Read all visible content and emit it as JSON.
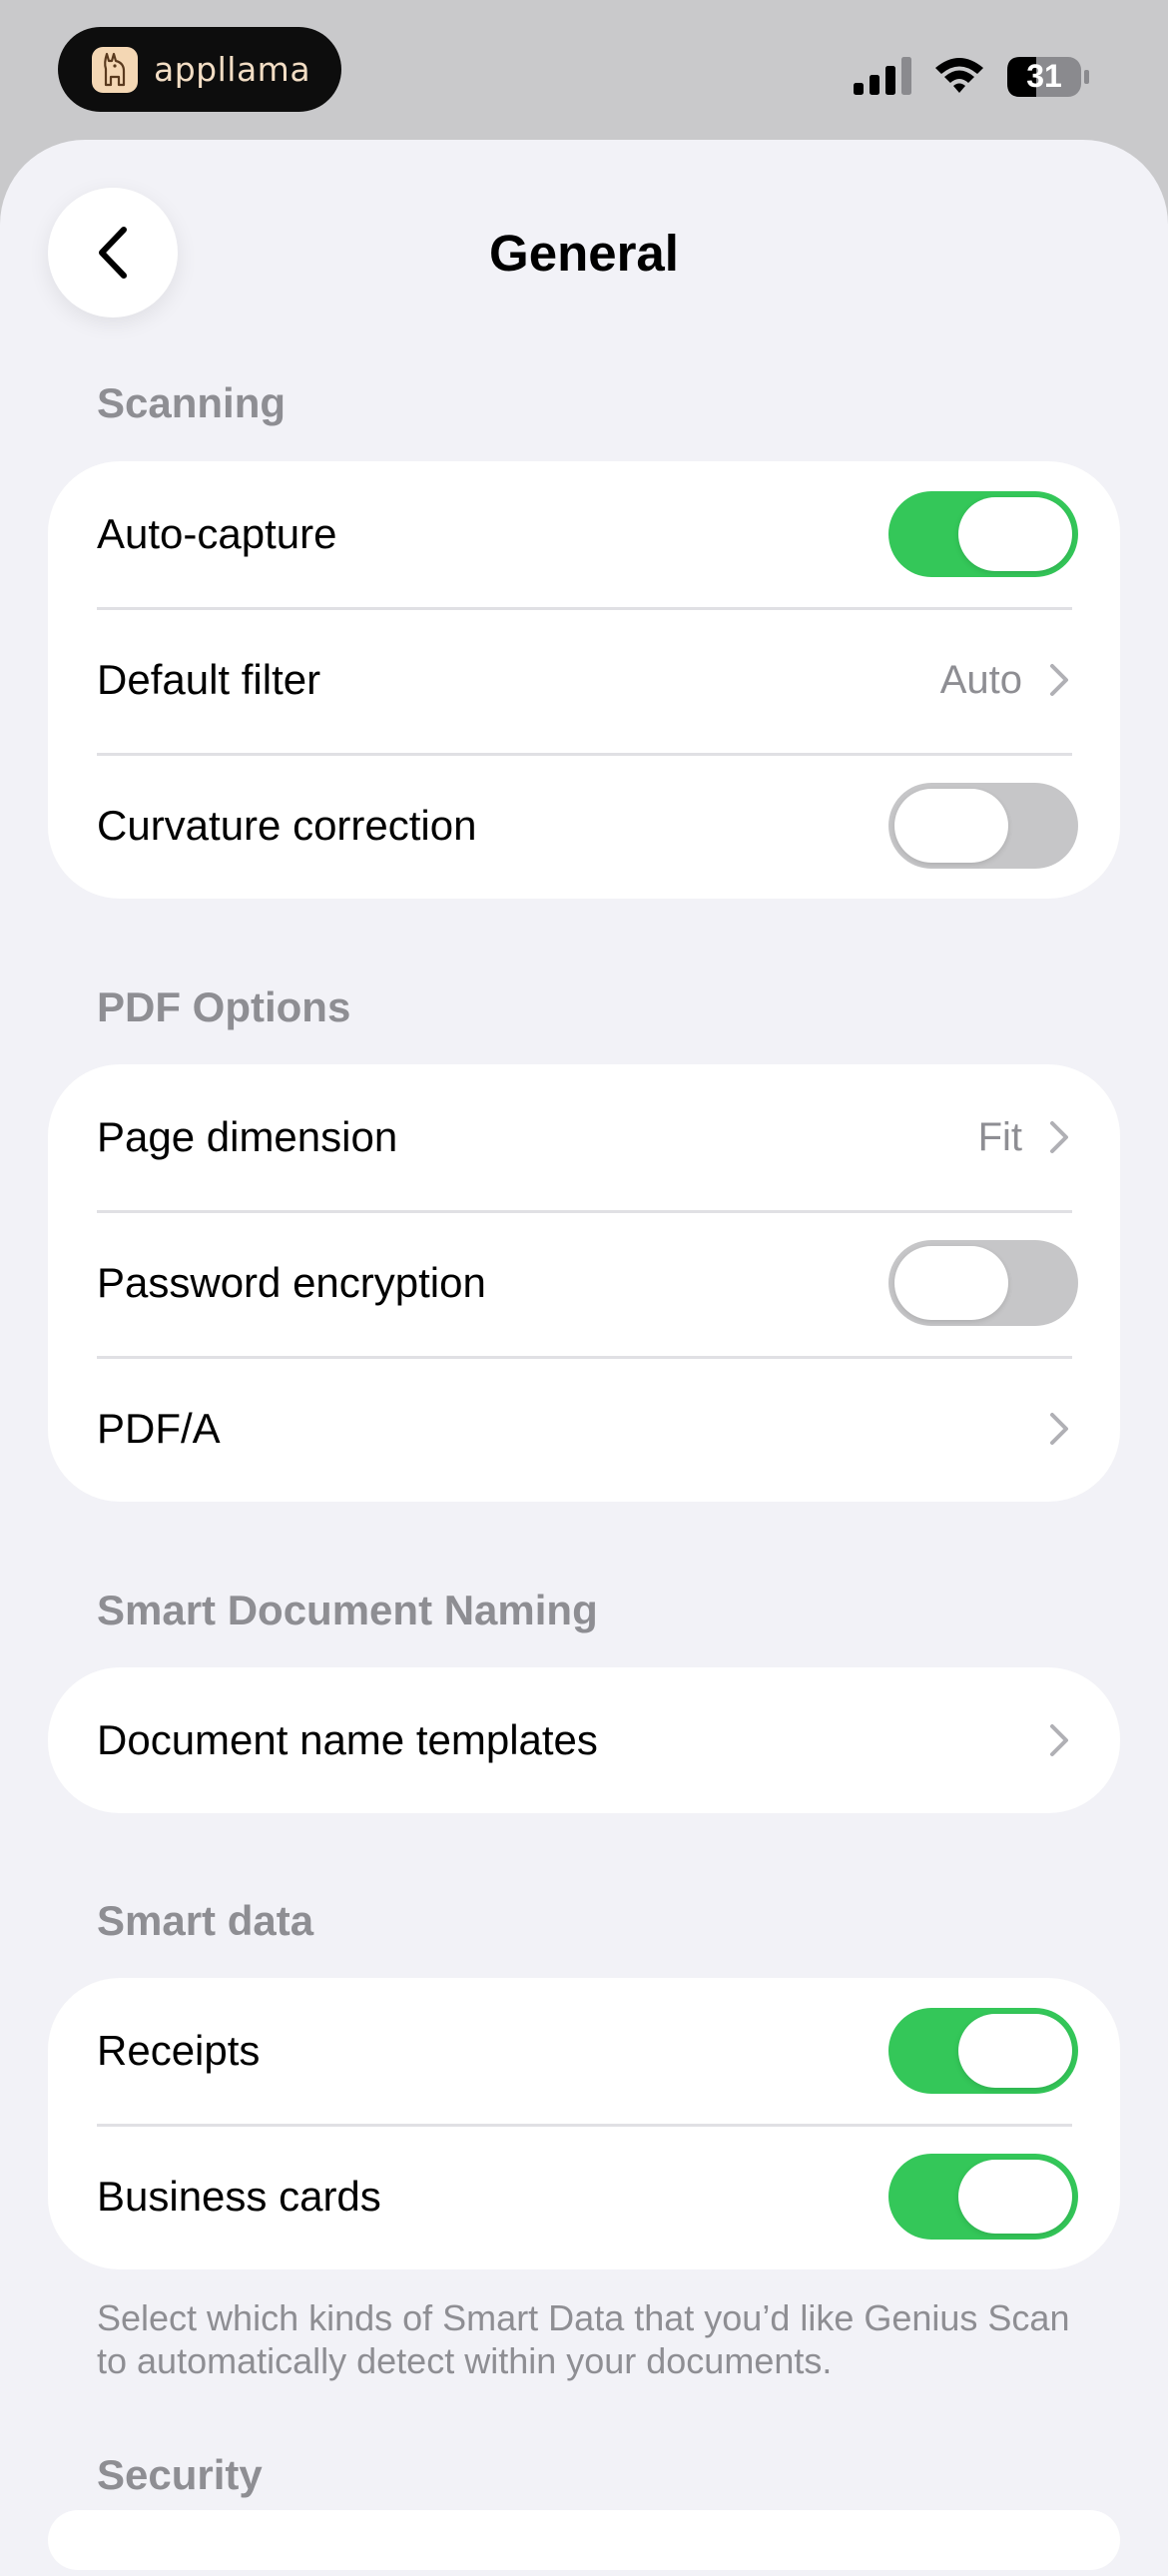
{
  "status_bar": {
    "brand_name": "appllama",
    "battery_level": "31",
    "icons": [
      "cellular-signal-icon",
      "wifi-icon",
      "battery-icon"
    ]
  },
  "nav": {
    "title": "General",
    "back_icon": "chevron-left-icon"
  },
  "sections": {
    "scanning": {
      "header": "Scanning",
      "rows": [
        {
          "label": "Auto-capture",
          "type": "toggle",
          "on": true
        },
        {
          "label": "Default filter",
          "type": "disclosure",
          "value": "Auto"
        },
        {
          "label": "Curvature correction",
          "type": "toggle",
          "on": false
        }
      ]
    },
    "pdf_options": {
      "header": "PDF Options",
      "rows": [
        {
          "label": "Page dimension",
          "type": "disclosure",
          "value": "Fit"
        },
        {
          "label": "Password encryption",
          "type": "toggle",
          "on": false
        },
        {
          "label": "PDF/A",
          "type": "disclosure",
          "value": ""
        }
      ]
    },
    "smart_naming": {
      "header": "Smart Document Naming",
      "rows": [
        {
          "label": "Document name templates",
          "type": "disclosure",
          "value": ""
        }
      ]
    },
    "smart_data": {
      "header": "Smart data",
      "rows": [
        {
          "label": "Receipts",
          "type": "toggle",
          "on": true
        },
        {
          "label": "Business cards",
          "type": "toggle",
          "on": true
        }
      ],
      "footnote": "Select which kinds of Smart Data that you’d like Genius Scan to automatically detect within your documents."
    },
    "security": {
      "header": "Security"
    }
  },
  "colors": {
    "toggle_on": "#34c759",
    "toggle_off": "#c6c6c8",
    "background": "#f2f2f7",
    "secondary_text": "#8e8e93"
  }
}
